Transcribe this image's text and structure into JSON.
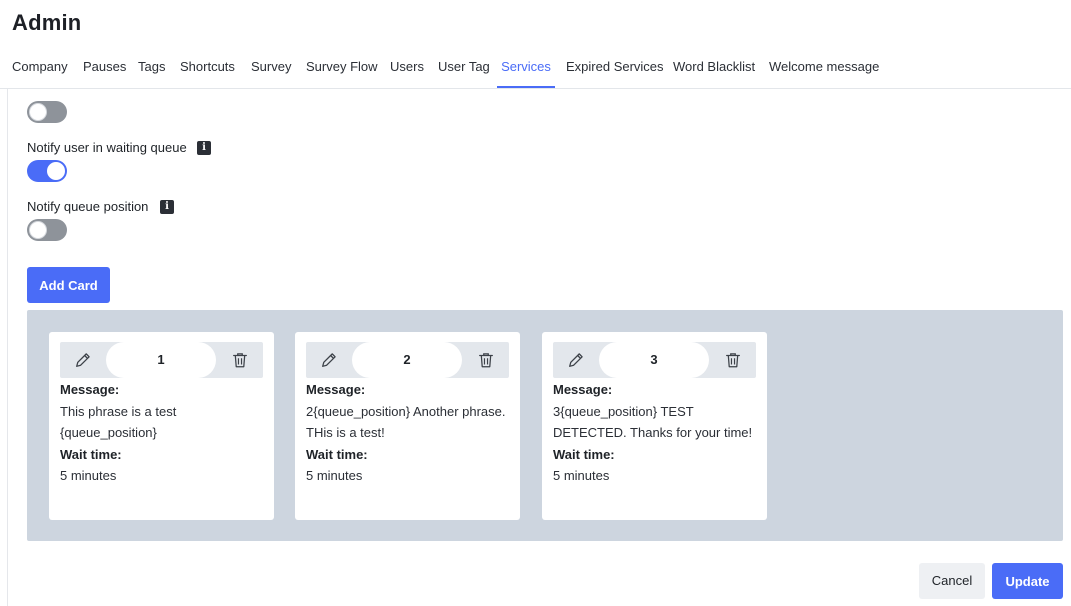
{
  "page": {
    "title": "Admin"
  },
  "tabs": [
    {
      "label": "Company"
    },
    {
      "label": "Pauses"
    },
    {
      "label": "Tags"
    },
    {
      "label": "Shortcuts"
    },
    {
      "label": "Survey"
    },
    {
      "label": "Survey Flow"
    },
    {
      "label": "Users"
    },
    {
      "label": "User Tag"
    },
    {
      "label": "Services"
    },
    {
      "label": "Expired Services"
    },
    {
      "label": "Word Blacklist"
    },
    {
      "label": "Welcome message"
    }
  ],
  "active_tab": "Services",
  "options": {
    "top_toggle_state": "off",
    "notify_waiting_queue": {
      "label": "Notify user in waiting queue",
      "state": "on",
      "info_icon": "i"
    },
    "notify_queue_position": {
      "label": "Notify queue position",
      "state": "off",
      "info_icon": "i"
    }
  },
  "add_card_label": "Add Card",
  "cards": [
    {
      "number": "1",
      "message_label": "Message:",
      "message": "This phrase is a test {queue_position}",
      "wait_label": "Wait time:",
      "wait": "5 minutes"
    },
    {
      "number": "2",
      "message_label": "Message:",
      "message": "2{queue_position} Another phrase. THis is a test!",
      "wait_label": "Wait time:",
      "wait": "5 minutes"
    },
    {
      "number": "3",
      "message_label": "Message:",
      "message": "3{queue_position} TEST DETECTED. Thanks for your time!",
      "wait_label": "Wait time:",
      "wait": "5 minutes"
    }
  ],
  "footer": {
    "cancel_label": "Cancel",
    "update_label": "Update"
  },
  "colors": {
    "accent": "#4a6cf7",
    "panel": "#cdd5df",
    "toggle_off": "#8e939a"
  },
  "icons": {
    "edit": "pencil-icon",
    "delete": "trash-icon",
    "info": "info-icon"
  }
}
